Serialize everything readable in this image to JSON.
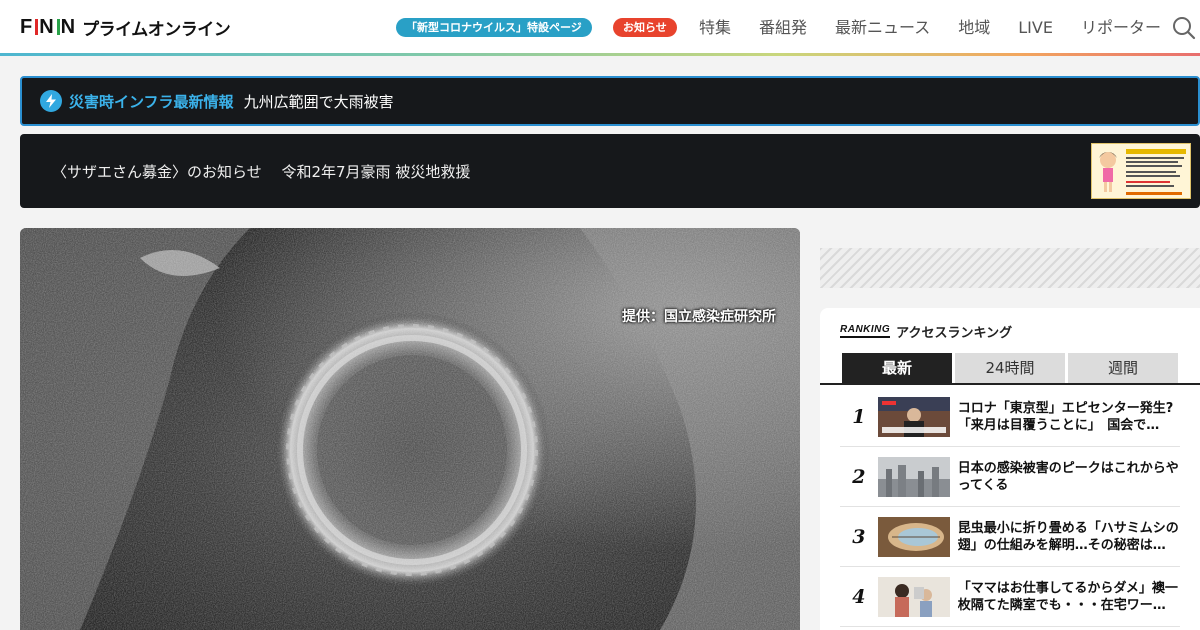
{
  "header": {
    "logo_fnn": "FNN",
    "logo_text": "プライムオンライン",
    "pill_corona": "「新型コロナウイルス」特設ページ",
    "pill_notice": "お知らせ",
    "nav": [
      "特集",
      "番組発",
      "最新ニュース",
      "地域",
      "LIVE",
      "リポーター"
    ],
    "search_icon": "search-icon"
  },
  "disaster": {
    "icon": "bolt-icon",
    "title": "災害時インフラ最新情報",
    "text": "九州広範囲で大雨被害"
  },
  "sazae": {
    "text": "〈サザエさん募金〉のお知らせ　 令和2年7月豪雨 被災地救援"
  },
  "hero": {
    "credit": "提供：国立感染症研究所"
  },
  "ranking": {
    "logo": "RANKING",
    "title": "アクセスランキング",
    "tabs": [
      "最新",
      "24時間",
      "週間"
    ],
    "items": [
      {
        "num": "1",
        "text": "コロナ「東京型」エピセンター発生?「来月は目覆うことに」　国会で…"
      },
      {
        "num": "2",
        "text": "日本の感染被害のピークはこれからやってくる"
      },
      {
        "num": "3",
        "text": "昆虫最小に折り畳める「ハサミムシの翅」の仕組みを解明…その秘密は…"
      },
      {
        "num": "4",
        "text": "「ママはお仕事してるからダメ」襖一枚隔てた隣室でも・・・在宅ワー…"
      }
    ]
  }
}
